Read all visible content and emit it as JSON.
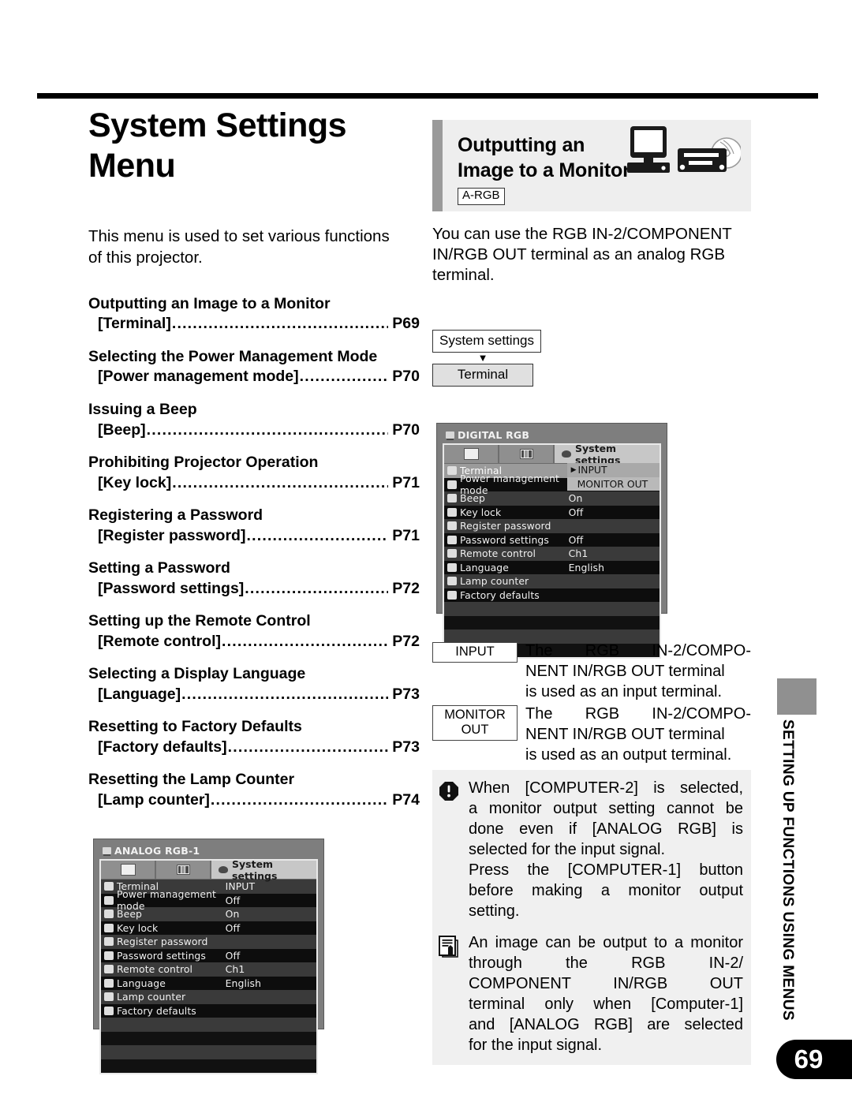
{
  "page": {
    "number": "69",
    "side_tab": "SETTING UP FUNCTIONS USING MENUS"
  },
  "left": {
    "title": "System Settings Menu",
    "intro": "This menu is used to set various functions of this projector.",
    "toc": [
      {
        "heading": "Outputting an Image to a Monitor",
        "bracket": "[Terminal]",
        "page": "P69"
      },
      {
        "heading": "Selecting the Power Management Mode",
        "bracket": "[Power management mode]",
        "page": "P70"
      },
      {
        "heading": "Issuing a Beep",
        "bracket": "[Beep]",
        "page": "P70"
      },
      {
        "heading": "Prohibiting Projector Operation",
        "bracket": "[Key lock]",
        "page": "P71"
      },
      {
        "heading": "Registering a Password",
        "bracket": "[Register password]",
        "page": "P71"
      },
      {
        "heading": "Setting a Password",
        "bracket": "[Password settings]",
        "page": "P72"
      },
      {
        "heading": "Setting up the Remote Control",
        "bracket": "[Remote control]",
        "page": "P72"
      },
      {
        "heading": "Selecting a Display Language",
        "bracket": "[Language]",
        "page": "P73"
      },
      {
        "heading": "Resetting to Factory Defaults",
        "bracket": "[Factory defaults]",
        "page": "P73"
      },
      {
        "heading": "Resetting the Lamp Counter",
        "bracket": "[Lamp counter]",
        "page": "P74"
      }
    ]
  },
  "osd_analog": {
    "title": "ANALOG RGB-1",
    "active_tab": "System settings",
    "rows": [
      {
        "label": "Terminal",
        "value": "INPUT"
      },
      {
        "label": "Power management mode",
        "value": "Off"
      },
      {
        "label": "Beep",
        "value": "On"
      },
      {
        "label": "Key lock",
        "value": "Off"
      },
      {
        "label": "Register password",
        "value": ""
      },
      {
        "label": "Password settings",
        "value": "Off"
      },
      {
        "label": "Remote control",
        "value": "Ch1"
      },
      {
        "label": "Language",
        "value": "English"
      },
      {
        "label": "Lamp counter",
        "value": ""
      },
      {
        "label": "Factory defaults",
        "value": ""
      }
    ]
  },
  "osd_digital": {
    "title": "DIGITAL RGB",
    "active_tab": "System settings",
    "rows": [
      {
        "label": "Terminal",
        "value": "INPUT"
      },
      {
        "label": "Power management mode",
        "value": ""
      },
      {
        "label": "Beep",
        "value": "On"
      },
      {
        "label": "Key lock",
        "value": "Off"
      },
      {
        "label": "Register password",
        "value": ""
      },
      {
        "label": "Password settings",
        "value": "Off"
      },
      {
        "label": "Remote control",
        "value": "Ch1"
      },
      {
        "label": "Language",
        "value": "English"
      },
      {
        "label": "Lamp counter",
        "value": ""
      },
      {
        "label": "Factory defaults",
        "value": ""
      }
    ],
    "popup_option_1": "INPUT",
    "popup_option_2": "MONITOR OUT"
  },
  "right": {
    "banner_title_line1": "Outputting an",
    "banner_title_line2": "Image to a Monitor",
    "banner_tag": "A-RGB",
    "intro": "You can use the RGB IN-2/COMPONENT IN/RGB OUT terminal as an analog RGB terminal.",
    "flow_from": "System settings",
    "flow_to": "Terminal",
    "terminal_modes": [
      {
        "tag": "INPUT",
        "line1": "The RGB IN-2/COMPO-",
        "line2": "NENT IN/RGB OUT terminal",
        "line3": "is used as an input terminal."
      },
      {
        "tag": "MONITOR OUT",
        "line1": "The RGB IN-2/COMPO-",
        "line2": "NENT IN/RGB OUT terminal",
        "line3": "is used as an output terminal."
      }
    ],
    "note_warning": {
      "l1": "When [COMPUTER-2] is selected,",
      "l2": "a monitor output setting cannot be",
      "l3": "done even if [ANALOG RGB] is",
      "l4": "selected for the input signal.",
      "l5": "Press the [COMPUTER-1] button",
      "l6": "before making a monitor output",
      "l7": "setting."
    },
    "note_memo": {
      "l1": "An image can be output to a monitor",
      "l2": "through the RGB IN-2/",
      "l3": "COMPONENT IN/RGB OUT",
      "l4": "terminal only when [Computer-1]",
      "l5": "and [ANALOG RGB] are selected",
      "l6": "for the input signal."
    }
  }
}
